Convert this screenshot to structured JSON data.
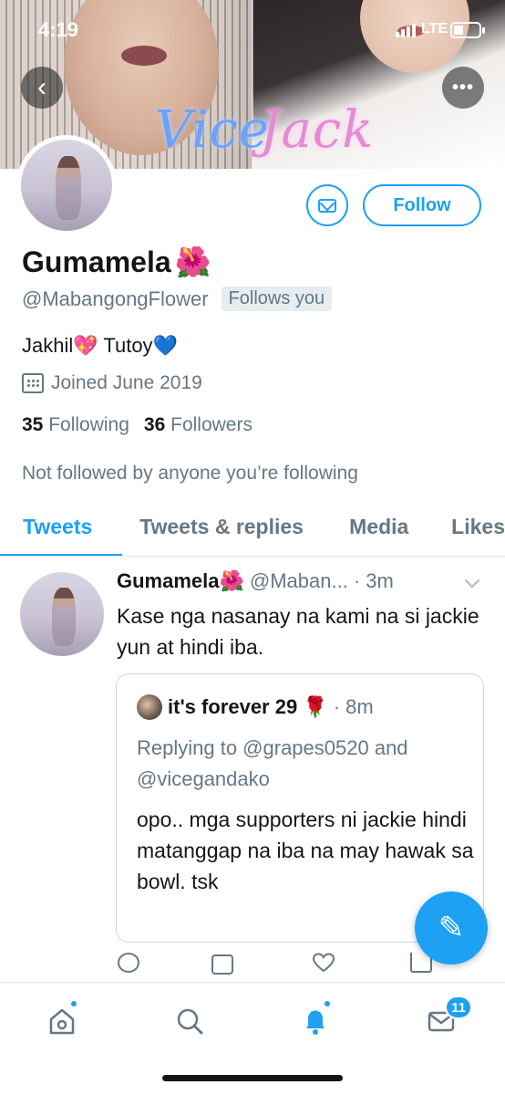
{
  "status_bar": {
    "time": "4:19",
    "network": "LTE"
  },
  "banner": {
    "text_left": "Vice",
    "text_right": "Jack"
  },
  "profile": {
    "name": "Gumamela",
    "name_emoji": "🌺",
    "handle": "@MabangongFlower",
    "follows_you": "Follows you",
    "bio": "Jakhil💖 Tutoy💙",
    "joined": "Joined June 2019",
    "following_count": "35",
    "following_label": "Following",
    "followers_count": "36",
    "followers_label": "Followers",
    "not_followed": "Not followed by anyone you’re following",
    "follow_label": "Follow"
  },
  "tabs": [
    "Tweets",
    "Tweets & replies",
    "Media",
    "Likes"
  ],
  "tweet": {
    "name": "Gumamela🌺",
    "handle": "@Maban...",
    "time": "· 3m",
    "text": "Kase nga nasanay na kami na si jackie yun at hindi iba.",
    "quote": {
      "name": "it's forever 29 🌹",
      "time": "· 8m",
      "replying": "Replying to @grapes0520 and @vicegandako",
      "text": "opo.. mga supporters ni jackie hindi matanggap na iba na may hawak sa bowl. tsk"
    }
  },
  "bottom_nav": {
    "messages_badge": "11"
  },
  "colors": {
    "accent": "#1da1f2",
    "secondary_text": "#657786",
    "border": "#e1e8ed"
  },
  "icons": [
    "back-icon",
    "more-icon",
    "mail-icon",
    "calendar-icon",
    "reply-icon",
    "retweet-icon",
    "like-icon",
    "share-icon",
    "compose-icon",
    "home-icon",
    "search-icon",
    "notifications-icon",
    "messages-icon"
  ]
}
